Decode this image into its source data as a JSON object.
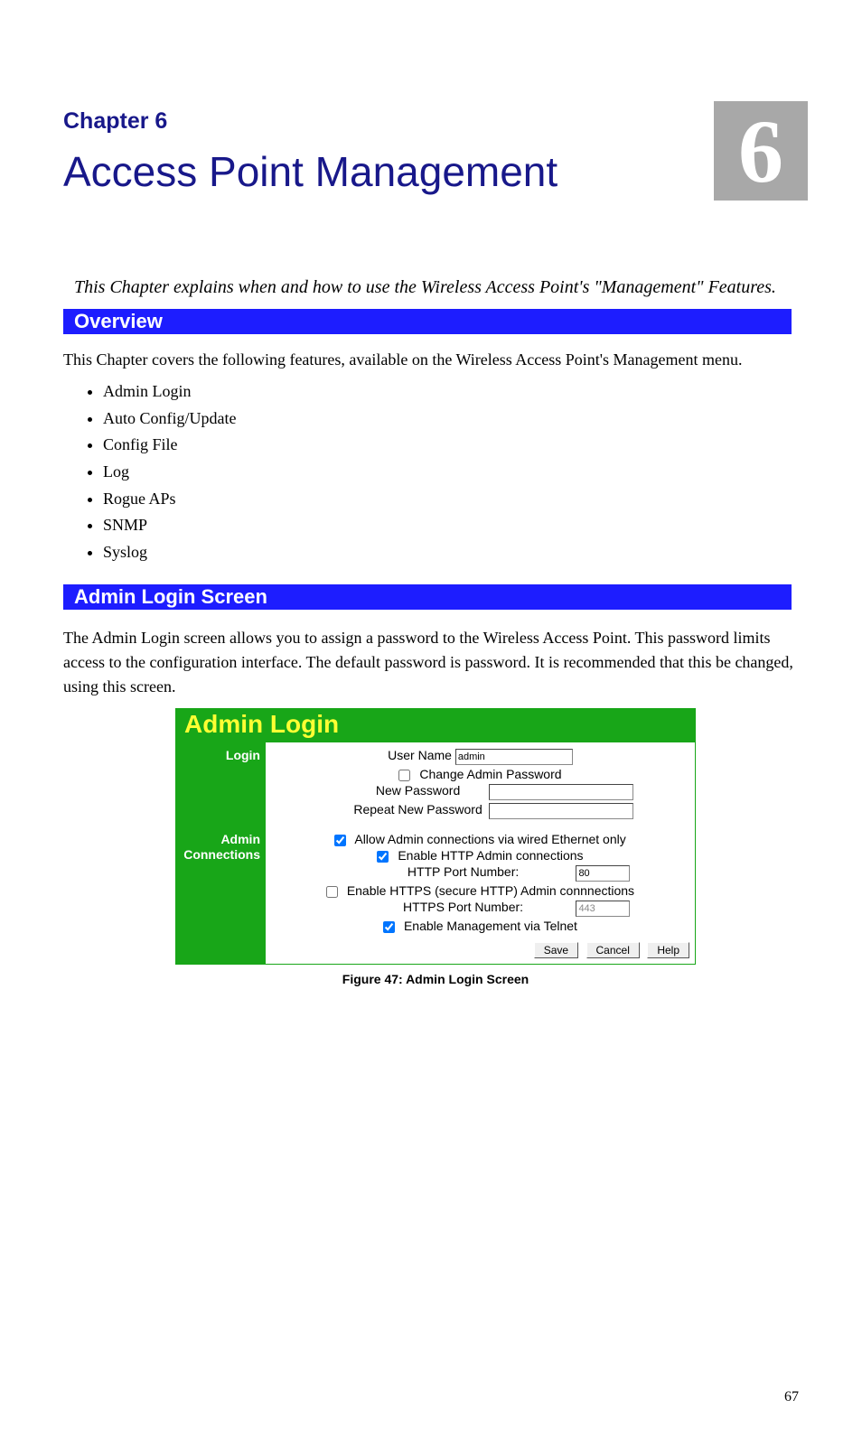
{
  "header": {
    "chapter_label": "Chapter 6",
    "title": "Access Point Management",
    "big_number": "6"
  },
  "intro": "This Chapter explains when and how to use the Wireless Access Point's \"Management\" Features.",
  "bars": {
    "overview_title": "Overview",
    "admin_login_title": "Admin Login Screen"
  },
  "overview_text": "This Chapter covers the following features, available on the Wireless Access Point's Management menu.",
  "bullets": [
    "Admin Login",
    "Auto Config/Update",
    "Config File",
    "Log",
    "Rogue APs",
    "SNMP",
    "Syslog"
  ],
  "account_text": "The Admin Login screen allows you to assign a password to the Wireless Access Point. This password limits access to the configuration interface. The default password is password. It is recommended that this be changed, using this screen.",
  "form": {
    "title": "Admin Login",
    "login_label": "Login",
    "user_name_label": "User Name",
    "user_name_value": "admin",
    "change_pw_label": "Change Admin Password",
    "change_pw_checked": false,
    "new_pw_label": "New Password",
    "new_pw_value": "",
    "repeat_pw_label": "Repeat New Password",
    "repeat_pw_value": "",
    "admin_conn_label": "Admin Connections",
    "wired_only_label": "Allow Admin connections via wired Ethernet only",
    "wired_only_checked": true,
    "http_enable_label": "Enable HTTP Admin connections",
    "http_enable_checked": true,
    "http_port_label": "HTTP Port Number:",
    "http_port_value": "80",
    "https_enable_label": "Enable HTTPS (secure HTTP) Admin connnections",
    "https_enable_checked": false,
    "https_port_label": "HTTPS Port Number:",
    "https_port_value": "443",
    "telnet_enable_label": "Enable Management via Telnet",
    "telnet_enable_checked": true,
    "save_btn": "Save",
    "cancel_btn": "Cancel",
    "help_btn": "Help"
  },
  "figure_caption": "Figure 47: Admin Login Screen",
  "page_number": "67"
}
